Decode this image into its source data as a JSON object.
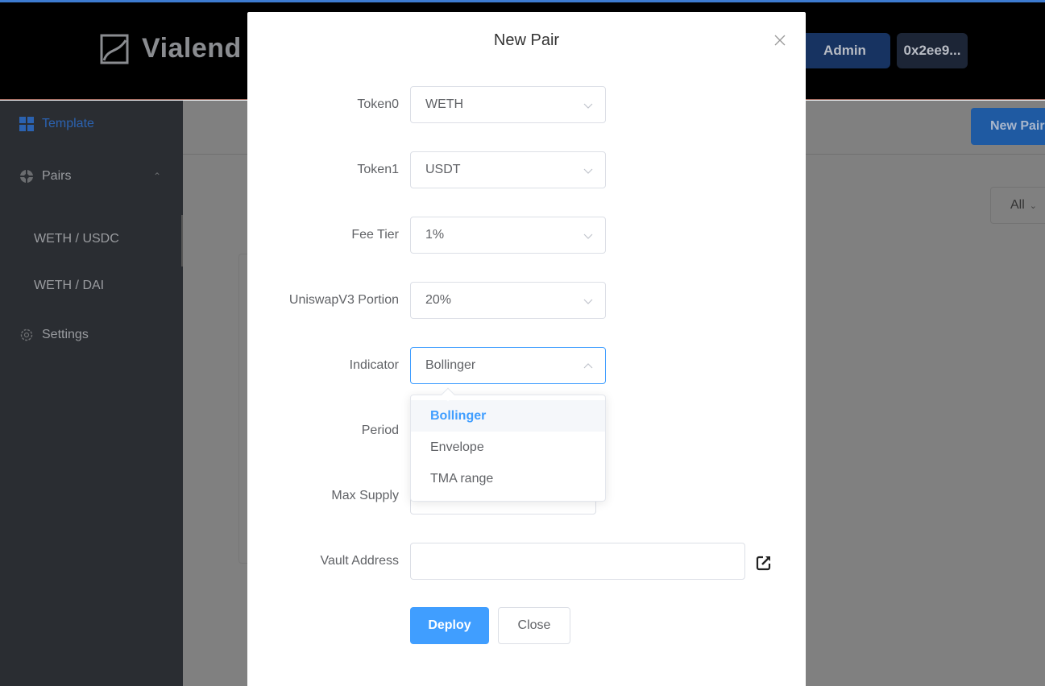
{
  "header": {
    "brand": "Vialend",
    "admin_label": "Admin",
    "wallet_address": "0x2ee9..."
  },
  "sidebar": {
    "items": [
      {
        "label": "Template",
        "icon": "grid-icon",
        "active": true
      },
      {
        "label": "Pairs",
        "icon": "pairs-icon",
        "expanded": true
      },
      {
        "label": "Settings",
        "icon": "gear-icon"
      }
    ],
    "pairs": [
      {
        "label": "WETH / USDC"
      },
      {
        "label": "WETH / DAI"
      }
    ]
  },
  "main": {
    "new_pair_label": "New Pair",
    "filter_value": "All"
  },
  "modal": {
    "title": "New Pair",
    "fields": {
      "token0": {
        "label": "Token0",
        "value": "WETH"
      },
      "token1": {
        "label": "Token1",
        "value": "USDT"
      },
      "fee_tier": {
        "label": "Fee Tier",
        "value": "1%"
      },
      "uniswap_portion": {
        "label": "UniswapV3 Portion",
        "value": "20%"
      },
      "indicator": {
        "label": "Indicator",
        "value": "Bollinger"
      },
      "period": {
        "label": "Period",
        "value": ""
      },
      "max_supply": {
        "label": "Max Supply",
        "value": ""
      },
      "vault_address": {
        "label": "Vault Address",
        "value": ""
      }
    },
    "indicator_options": [
      "Bollinger",
      "Envelope",
      "TMA range"
    ],
    "indicator_selected": "Bollinger",
    "deploy_label": "Deploy",
    "close_label": "Close"
  },
  "colors": {
    "primary": "#409eff",
    "header_bg": "#000000",
    "sidebar_bg": "#2a2d32",
    "overlay": "#808080"
  }
}
